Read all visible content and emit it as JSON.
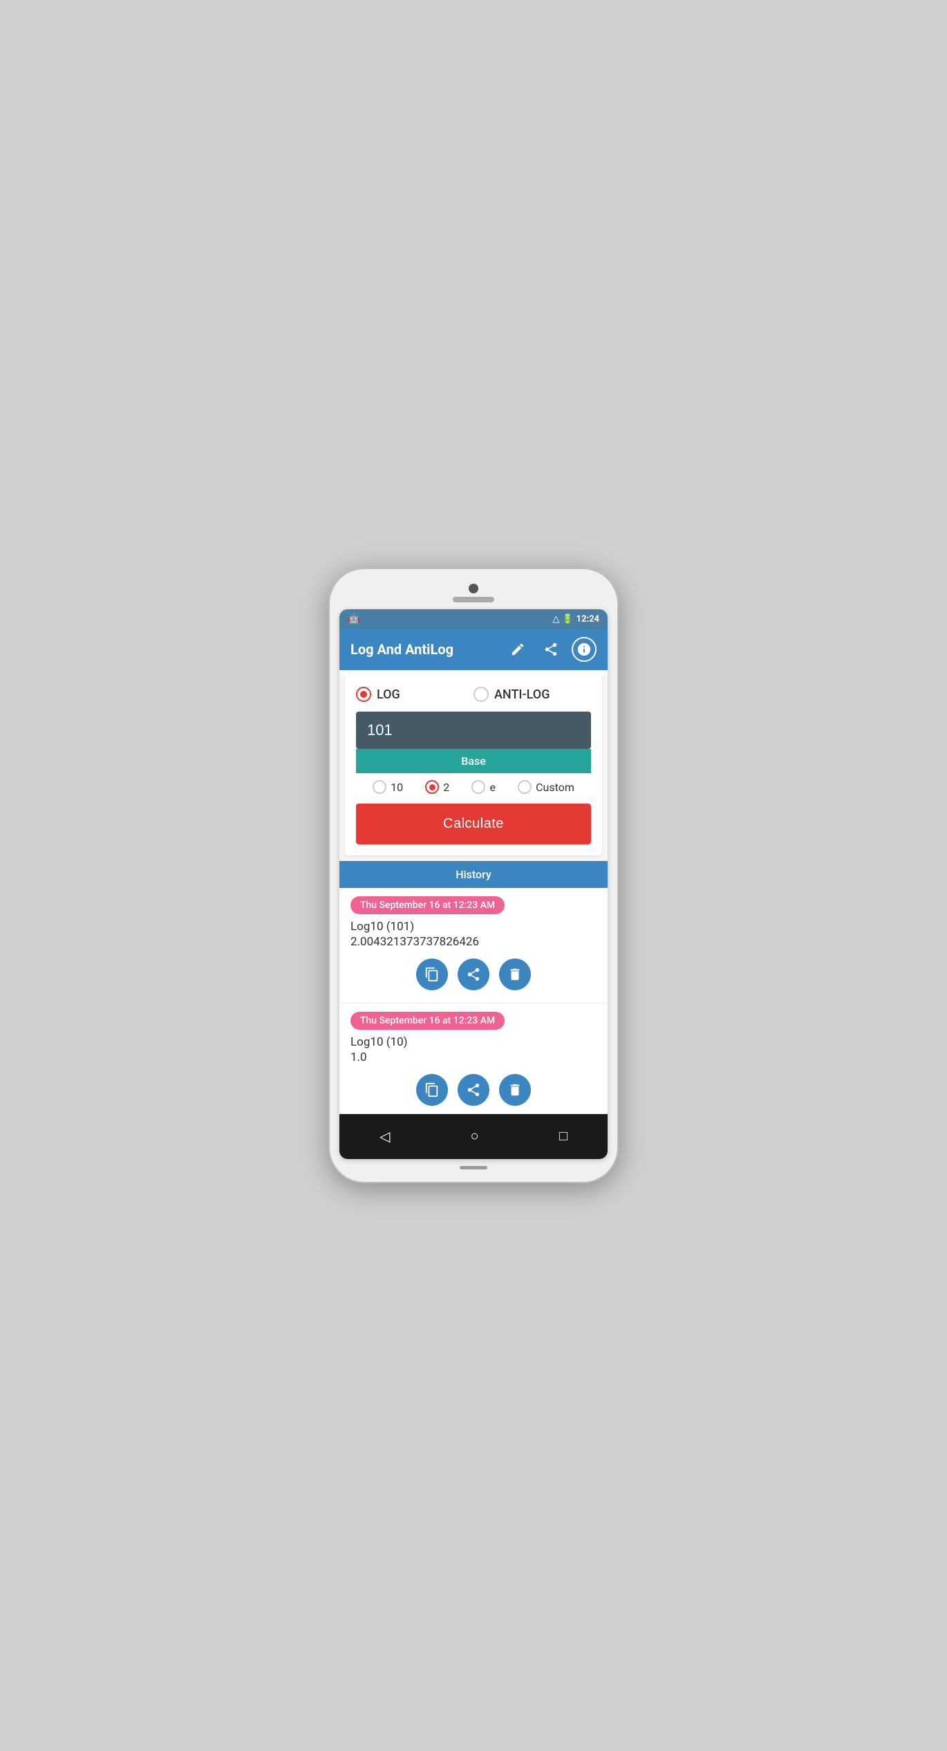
{
  "statusBar": {
    "time": "12:24",
    "androidIcon": "🤖"
  },
  "appBar": {
    "title": "Log And AntiLog",
    "editIcon": "edit",
    "shareIcon": "share",
    "infoIcon": "info"
  },
  "calculator": {
    "logLabel": "LOG",
    "antilogLabel": "ANTI-LOG",
    "logSelected": true,
    "inputValue": "101",
    "inputPlaceholder": "",
    "baseLabel": "Base",
    "baseOptions": [
      "10",
      "2",
      "e",
      "Custom"
    ],
    "baseSelected": "2",
    "calculateLabel": "Calculate"
  },
  "history": {
    "sectionLabel": "History",
    "items": [
      {
        "timestamp": "Thu September 16 at 12:23 AM",
        "expression": "Log10 (101)",
        "result": "2.00432137373782642​6"
      },
      {
        "timestamp": "Thu September 16 at 12:23 AM",
        "expression": "Log10 (10)",
        "result": "1.0"
      }
    ]
  },
  "bottomNav": {
    "backLabel": "◁",
    "homeLabel": "○",
    "recentLabel": "□"
  }
}
